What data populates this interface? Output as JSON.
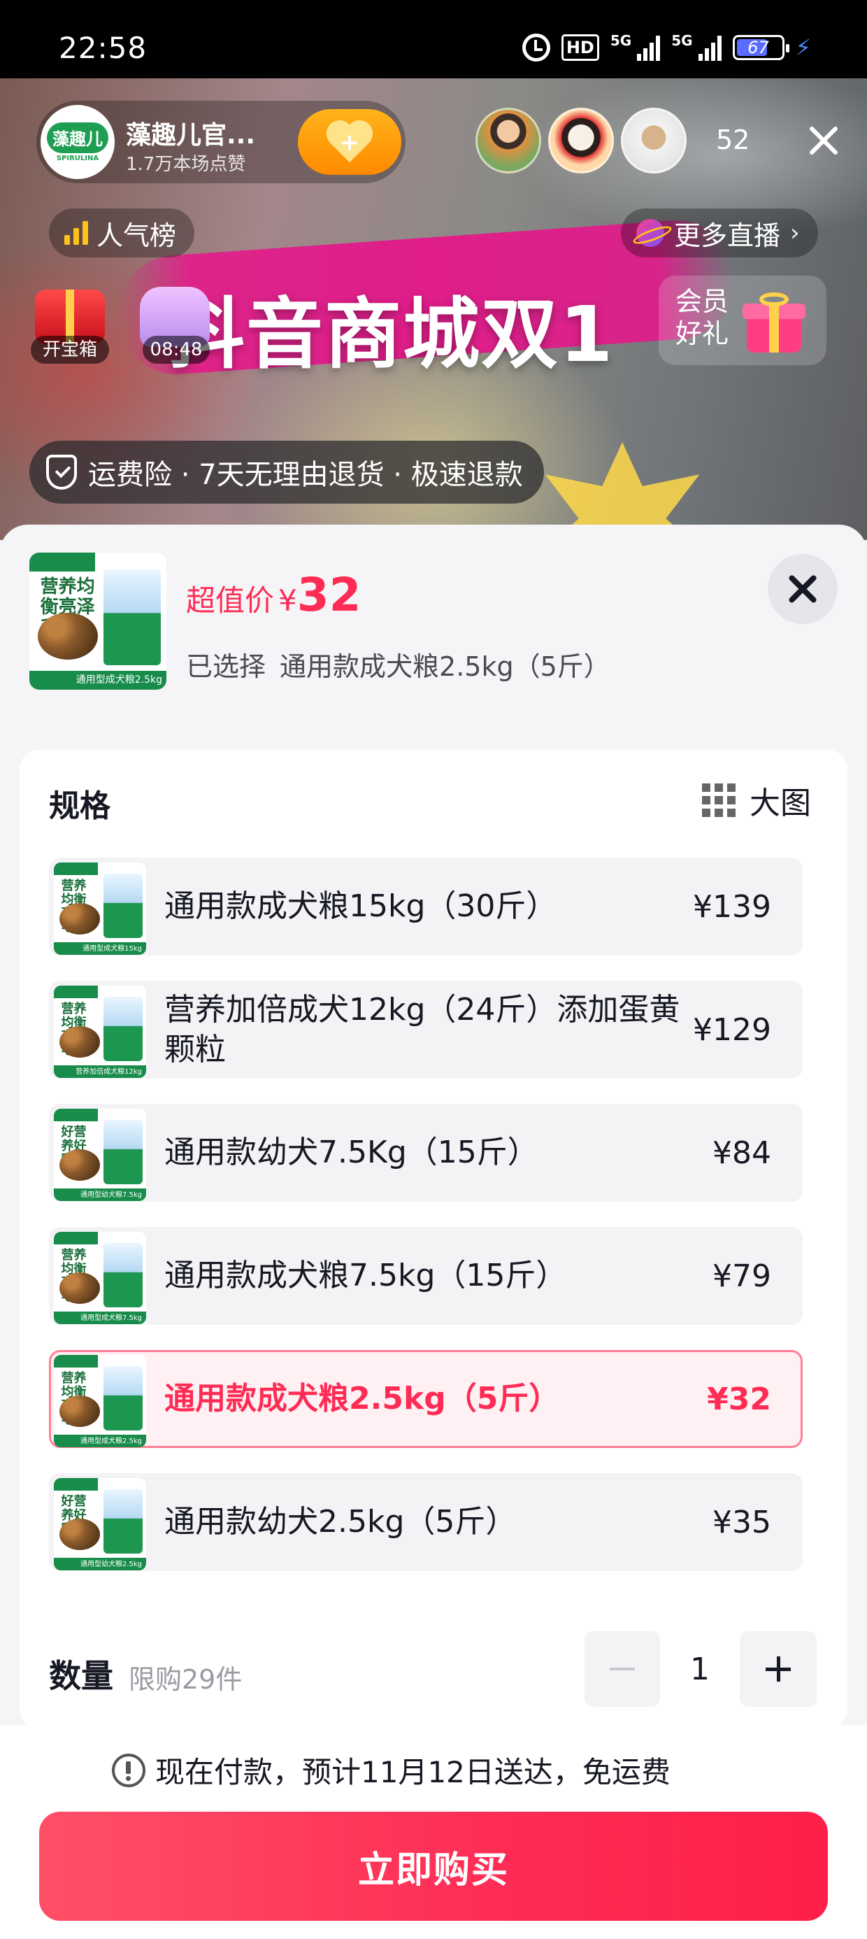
{
  "status_bar": {
    "time": "22:58",
    "hd_label": "HD",
    "signal_1_label": "5G",
    "signal_2_label": "5G",
    "battery_level": "67"
  },
  "live": {
    "streamer_name": "藻趣儿官...",
    "streamer_likes": "1.7万本场点赞",
    "logo_text": "藻趣儿",
    "logo_sub": "SPIRULINA",
    "follow_icon": "heart-plus-icon",
    "viewer_count": "52",
    "rank_label": "人气榜",
    "more_live_label": "更多直播",
    "banner_text": "抖音商城双1",
    "treasure_label": "开宝箱",
    "gift_timer": "08:48",
    "member_gift_label": "会员好礼",
    "guarantee_text": "运费险 · 7天无理由退货 · 极速退款"
  },
  "product": {
    "thumb_head": "营养均衡亮泽毛发",
    "thumb_foot": "通用型成犬粮2.5kg",
    "price_label": "超值价",
    "price_symbol": "¥",
    "price_value": "32",
    "selected_label": "已选择",
    "selected_value": "通用款成犬粮2.5kg（5斤）"
  },
  "spec": {
    "title": "规格",
    "big_image_label": "大图",
    "options": [
      {
        "label": "通用款成犬粮15kg（30斤）",
        "price": "¥139",
        "thumb_head": "营养均衡亮泽毛发",
        "thumb_foot": "通用型成犬粮15kg"
      },
      {
        "label": "营养加倍成犬12kg（24斤）添加蛋黄颗粒",
        "price": "¥129",
        "thumb_head": "营养均衡亮泽毛发",
        "thumb_foot": "营养加倍成犬粮12kg"
      },
      {
        "label": "通用款幼犬7.5Kg（15斤）",
        "price": "¥84",
        "thumb_head": "好营养好吸收",
        "thumb_foot": "通用型幼犬粮7.5kg"
      },
      {
        "label": "通用款成犬粮7.5kg（15斤）",
        "price": "¥79",
        "thumb_head": "营养均衡亮泽毛发",
        "thumb_foot": "通用型成犬粮7.5kg"
      },
      {
        "label": "通用款成犬粮2.5kg（5斤）",
        "price": "¥32",
        "thumb_head": "营养均衡亮泽毛发",
        "thumb_foot": "通用型成犬粮2.5kg"
      },
      {
        "label": "通用款幼犬2.5kg（5斤）",
        "price": "¥35",
        "thumb_head": "好营养好吸收",
        "thumb_foot": "通用型幼犬粮2.5kg"
      }
    ],
    "selected_index": 4
  },
  "quantity": {
    "title": "数量",
    "limit": "限购29件",
    "value": "1"
  },
  "footer": {
    "delivery_note": "现在付款，预计11月12日送达，免运费",
    "buy_label": "立即购买"
  },
  "colors": {
    "accent": "#fe2c55",
    "selected_bg": "#fff1f3",
    "brand_green": "#188c4a"
  }
}
